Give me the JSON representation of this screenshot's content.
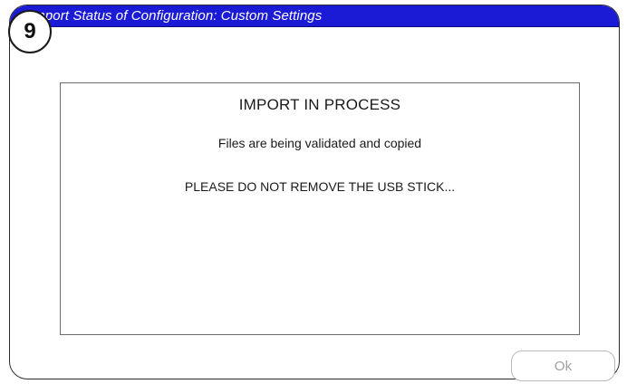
{
  "step_badge": "9",
  "dialog": {
    "title": "Import Status of Configuration: Custom Settings"
  },
  "message": {
    "heading": "IMPORT IN PROCESS",
    "line1": "Files are being validated and copied",
    "line2": "PLEASE DO NOT REMOVE THE USB STICK..."
  },
  "footer": {
    "ok_label": "Ok",
    "ok_state": "disabled"
  },
  "colors": {
    "title_bar": "#1b1bd6",
    "border": "#2a2a2a",
    "disabled_text": "#a0a0a0"
  }
}
